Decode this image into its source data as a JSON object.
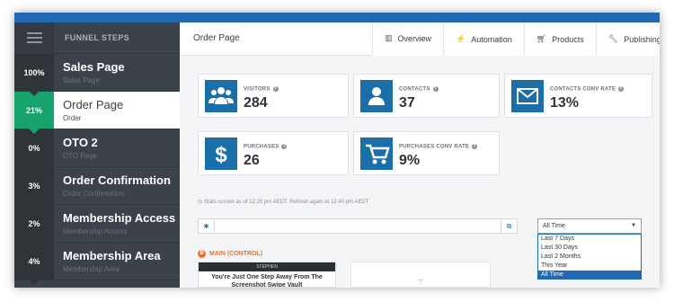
{
  "sidebar": {
    "title": "FUNNEL STEPS",
    "steps": [
      {
        "pct": "100%",
        "name": "Sales Page",
        "sub": "Sales Page"
      },
      {
        "pct": "21%",
        "name": "Order Page",
        "sub": "Order"
      },
      {
        "pct": "0%",
        "name": "OTO 2",
        "sub": "OTO Page"
      },
      {
        "pct": "3%",
        "name": "Order Confirmation",
        "sub": "Order Confirmation"
      },
      {
        "pct": "2%",
        "name": "Membership Access",
        "sub": "Membership Access"
      },
      {
        "pct": "4%",
        "name": "Membership Area",
        "sub": "Membership Area"
      }
    ]
  },
  "header": {
    "title": "Order Page",
    "tabs": [
      {
        "label": "Overview",
        "icon": "bar-chart-icon"
      },
      {
        "label": "Automation",
        "icon": "bolt-icon"
      },
      {
        "label": "Products",
        "icon": "cart-icon"
      },
      {
        "label": "Publishing",
        "icon": "wrench-icon"
      }
    ]
  },
  "stats": {
    "visitors": {
      "label": "VISITORS",
      "value": "284"
    },
    "contacts": {
      "label": "CONTACTS",
      "value": "37"
    },
    "contacts_conv": {
      "label": "CONTACTS CONV RATE",
      "value": "13%"
    },
    "purchases": {
      "label": "PURCHASES",
      "value": "26"
    },
    "purchases_conv": {
      "label": "PURCHASES CONV RATE",
      "value": "9%"
    }
  },
  "note": "Stats current as of 12:20 pm AEDT. Refresh again at 12:40 pm AEDT",
  "range_select": {
    "value": "All Time",
    "options": [
      "Last 7 Days",
      "Last 30 Days",
      "Last 2 Months",
      "This Year",
      "All Time"
    ]
  },
  "section": {
    "badge": "B",
    "label": "MAIN (CONTROL)"
  },
  "thumb": {
    "brand": "STEPHEN",
    "caption": "You're Just One Step Away From The Screenshot Swipe Vault"
  },
  "colors": {
    "accent": "#1b6fa9",
    "active_step": "#16a46c",
    "sidebar": "#3c4249",
    "orange": "#e8732a"
  }
}
